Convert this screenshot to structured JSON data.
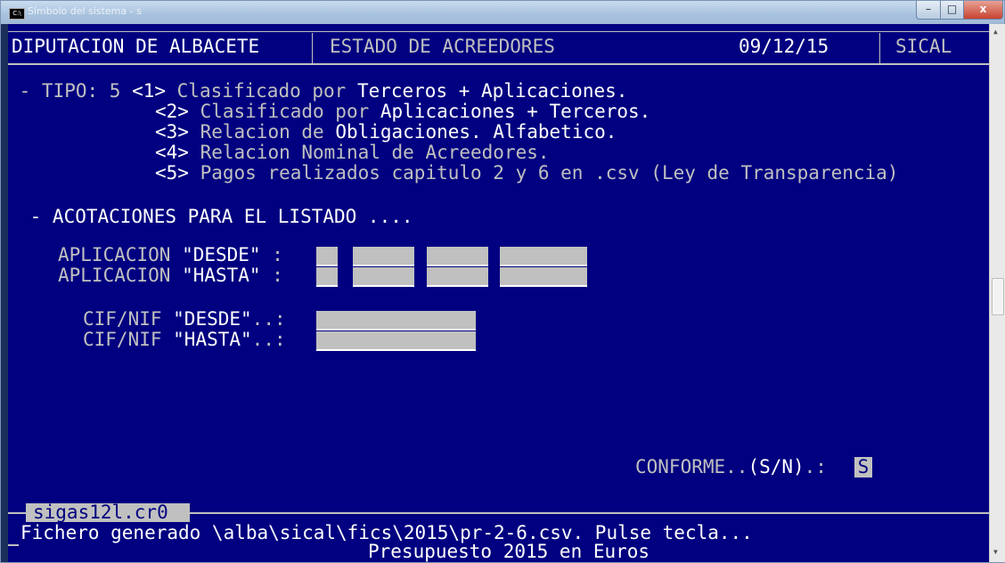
{
  "window": {
    "title": "Símbolo del sistema - s",
    "min_label": "–",
    "max_label": "□",
    "close_label": "x"
  },
  "header": {
    "org": "DIPUTACION DE ALBACETE",
    "screen": "ESTADO DE ACREEDORES",
    "date": "09/12/15",
    "app": "SICAL"
  },
  "tipo": {
    "prefix": " - TIPO: 5 ",
    "options": [
      {
        "key": "<1>",
        "text": " Clasificado por ",
        "hl": "Terceros + Aplicaciones."
      },
      {
        "key": "<2>",
        "text": " Clasificado por ",
        "hl": "Aplicaciones + Terceros."
      },
      {
        "key": "<3>",
        "text": " Relacion de ",
        "hl": "Obligaciones. Alfabetico."
      },
      {
        "key": "<4>",
        "text": " Relacion Nominal de Acreedores.",
        "hl": ""
      },
      {
        "key": "<5>",
        "text": " Pagos realizados capitulo 2 y 6 en .csv (Ley de Transparencia)",
        "hl": ""
      }
    ]
  },
  "acotaciones": " - ACOTACIONES PARA EL LISTADO ....",
  "fields": {
    "aplic_desde_label": "APLICACION ",
    "aplic_desde_q": "\"DESDE\"",
    "aplic_desde_colon": " :",
    "aplic_hasta_label": "APLICACION ",
    "aplic_hasta_q": "\"HASTA\"",
    "aplic_hasta_colon": " :",
    "cif_desde_label": "CIF/NIF ",
    "cif_desde_q": "\"DESDE\"",
    "cif_desde_colon": "..:",
    "cif_hasta_label": "CIF/NIF ",
    "cif_hasta_q": "\"HASTA\"",
    "cif_hasta_colon": "..:"
  },
  "conforme": {
    "label": "CONFORME..",
    "hint": "(S/N)",
    "colon": ".: ",
    "value": "S"
  },
  "status": {
    "file_tab": "sigas12l.cr0",
    "message": "Fichero generado \\alba\\sical\\fics\\2015\\pr-2-6.csv. Pulse tecla...",
    "footer": "Presupuesto 2015 en Euros"
  },
  "colors": {
    "console_bg": "#000080",
    "console_fg": "#c0c0c0",
    "highlight_fg": "#ffffff"
  }
}
